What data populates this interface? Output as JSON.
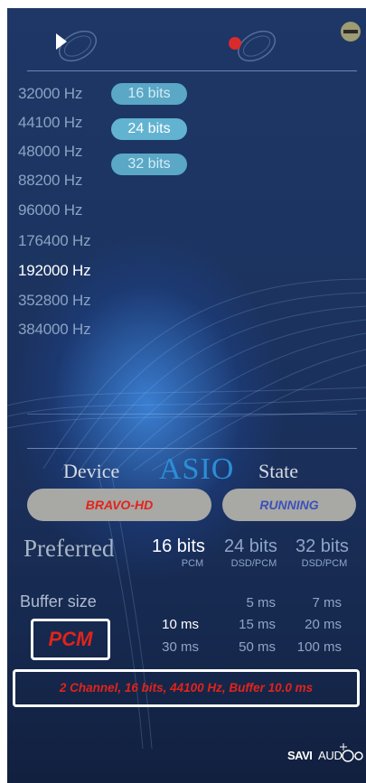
{
  "icons": {
    "play": "play-icon",
    "record": "record-icon",
    "minimize": "minimize-icon"
  },
  "colors": {
    "panel_bg": "#1c3461",
    "accent_blue": "#2b8fd6",
    "pill": "#5aa7c6",
    "status_red": "#e2231a",
    "status_blue": "#3d50b8",
    "record_red": "#d92b2b",
    "minimize_olive": "#9d9c72"
  },
  "sample_rates": [
    {
      "label": "32000 Hz",
      "active": false
    },
    {
      "label": "44100 Hz",
      "active": false
    },
    {
      "label": "48000 Hz",
      "active": false
    },
    {
      "label": "88200 Hz",
      "active": false
    },
    {
      "label": "96000 Hz",
      "active": false
    },
    {
      "label": "176400 Hz",
      "active": false
    },
    {
      "label": "192000 Hz",
      "active": true
    },
    {
      "label": "352800 Hz",
      "active": false
    },
    {
      "label": "384000 Hz",
      "active": false
    }
  ],
  "bit_depths": [
    {
      "label": "16 bits",
      "active": false
    },
    {
      "label": "24 bits",
      "active": true
    },
    {
      "label": "32 bits",
      "active": false
    }
  ],
  "device": {
    "device_label": "Device",
    "asio_label": "ASIO",
    "state_label": "State",
    "device_name": "BRAVO-HD",
    "state_value": "RUNNING"
  },
  "preferred": {
    "label": "Preferred",
    "options": [
      {
        "bits": "16 bits",
        "sub": "PCM",
        "active": true
      },
      {
        "bits": "24 bits",
        "sub": "DSD/PCM",
        "active": false
      },
      {
        "bits": "32 bits",
        "sub": "DSD/PCM",
        "active": false
      }
    ]
  },
  "buffer": {
    "label": "Buffer size",
    "options": [
      {
        "label": "5 ms",
        "active": false
      },
      {
        "label": "7 ms",
        "active": false
      },
      {
        "label": "10 ms",
        "active": true
      },
      {
        "label": "15 ms",
        "active": false
      },
      {
        "label": "20 ms",
        "active": false
      },
      {
        "label": "30 ms",
        "active": false
      },
      {
        "label": "50 ms",
        "active": false
      },
      {
        "label": "100 ms",
        "active": false
      }
    ]
  },
  "mode": "PCM",
  "status_line": "2 Channel, 16 bits, 44100 Hz, Buffer 10.0 ms",
  "brand": {
    "text": "SAVI AUDIO"
  }
}
